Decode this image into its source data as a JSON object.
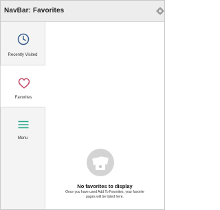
{
  "header": {
    "title": "NavBar: Favorites"
  },
  "sidebar": {
    "items": [
      {
        "label": "Recently Visited",
        "icon": "clock-icon"
      },
      {
        "label": "Favorites",
        "icon": "heart-icon"
      },
      {
        "label": "Menu",
        "icon": "menu-icon"
      }
    ]
  },
  "empty_state": {
    "title": "No favorites to display",
    "line1": "Once you have used Add To Favorites, your favorite",
    "line2": "pages will be listed here."
  },
  "colors": {
    "clock": "#3a5f8f",
    "heart": "#c24a68",
    "menu": "#2aa88a",
    "empty_icon": "#c9c9c9"
  }
}
